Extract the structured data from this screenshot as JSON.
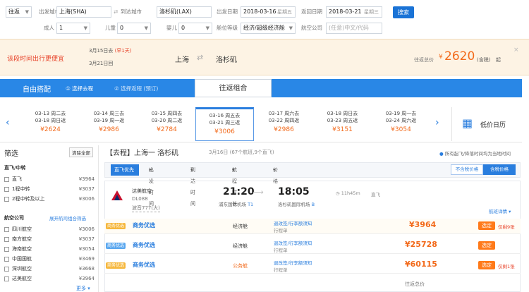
{
  "search": {
    "trip_type": "往返",
    "from_label": "出发城市",
    "from_value": "上海(SHA)",
    "swap_label": "到达城市",
    "to_value": "洛杉矶(LAX)",
    "depart_label": "出发日期",
    "depart_value": "2018-03-16",
    "depart_weekday": "星期五",
    "return_label": "返回日期",
    "return_value": "2018-03-21",
    "return_weekday": "星期三",
    "search_button": "搜索",
    "adult_label": "成人",
    "adult_value": "1",
    "child_label": "儿童",
    "child_value": "0",
    "infant_label": "婴儿",
    "infant_value": "0",
    "cabin_label": "舱位等级",
    "cabin_value": "经济/超级经济舱",
    "airline_label": "航空公司",
    "airline_placeholder": "(任意)中文/代码"
  },
  "promo": {
    "slogan": "该段时间出行更便宜",
    "date1": "3月15日去",
    "date1_note": "(早1天)",
    "date2": "3月21日回",
    "from": "上海",
    "to": "洛杉矶",
    "total_label": "往返总价",
    "currency": "¥",
    "price": "2620",
    "suffix": "(含税)",
    "tail": "起"
  },
  "tabs": {
    "custom": "自由搭配",
    "step1": "① 选择去程",
    "step2": "② 选择返程 (预订)",
    "combo": "往返组合"
  },
  "dates": [
    {
      "go": "03-13 周二去",
      "back": "03-18 周日返",
      "price": "¥2624"
    },
    {
      "go": "03-14 周三去",
      "back": "03-19 周一返",
      "price": "¥2986"
    },
    {
      "go": "03-15 周四去",
      "back": "03-20 周二返",
      "price": "¥2784"
    },
    {
      "go": "03-16 周五去",
      "back": "03-21 周三返",
      "price": "¥3006"
    },
    {
      "go": "03-17 周六去",
      "back": "03-22 周四返",
      "price": "¥2986"
    },
    {
      "go": "03-18 周日去",
      "back": "03-23 周五返",
      "price": "¥3151"
    },
    {
      "go": "03-19 周一去",
      "back": "03-24 周六返",
      "price": "¥3054"
    }
  ],
  "low_price_calendar": "低价日历",
  "filters": {
    "title": "筛选",
    "clear": "清除全部",
    "direct_title": "直飞/中转",
    "direct_items": [
      {
        "label": "直飞",
        "price": "¥3964"
      },
      {
        "label": "1程中转",
        "price": "¥3037"
      },
      {
        "label": "2程中转及以上",
        "price": "¥3006"
      }
    ],
    "airline_title": "航空公司",
    "airline_link": "展开航司组合筛选",
    "airlines": [
      {
        "label": "四川航空",
        "price": "¥3006"
      },
      {
        "label": "南方航空",
        "price": "¥3037"
      },
      {
        "label": "海南航空",
        "price": "¥3054"
      },
      {
        "label": "中国国航",
        "price": "¥3469"
      },
      {
        "label": "深圳航空",
        "price": "¥3668"
      },
      {
        "label": "达美航空",
        "price": "¥3964"
      }
    ],
    "more": "更多"
  },
  "result": {
    "heading_tag": "【去程】",
    "heading_route": "上海一 洛杉矶",
    "heading_sub": "3月16日 (67个航班,9个直飞)",
    "note": "所有起飞/降落时间均为当地时间",
    "sort_tabs": [
      "直飞优先",
      "出发时间",
      "到达时间",
      "航程时长",
      "价格"
    ],
    "price_toggle": [
      "不含税价格",
      "含税价格"
    ],
    "flight": {
      "airline": "达美航空",
      "flight_no": "DL088",
      "aircraft": "波音777(大)",
      "dep_time": "21:20",
      "dep_airport": "浦东国际机场",
      "dep_terminal": "T1",
      "arr_time": "18:05",
      "arr_airport": "洛杉矶国际机场",
      "arr_terminal": "B",
      "duration": "11h45m",
      "stop": "直飞",
      "detail_link": "航班详情"
    },
    "offers": [
      {
        "tag": "商务优选",
        "cabin": "经济舱",
        "badge": "退改签/行李额须知",
        "sub": "行程单",
        "price": "¥3964",
        "book": "选定",
        "extra": "仅剩9张",
        "promo": "商务优选"
      },
      {
        "tag": "商务优选",
        "cabin": "经济舱",
        "badge": "退改签/行李额须知",
        "sub": "行程单",
        "price": "¥25728",
        "book": "选定",
        "extra": "",
        "promo": "商务优选"
      },
      {
        "tag": "商务优选",
        "cabin": "公务舱",
        "badge": "退改签/行李额须知",
        "sub": "行程单",
        "price": "¥60115",
        "book": "选定",
        "extra": "仅剩1张",
        "promo": "商务优选"
      }
    ],
    "bottom_label": "往返总价"
  },
  "colors": {
    "accent_blue": "#2987e6",
    "price_orange": "#f26a1b",
    "book_orange": "#ff7a1a",
    "promo_bg": "#fdf3e4"
  }
}
